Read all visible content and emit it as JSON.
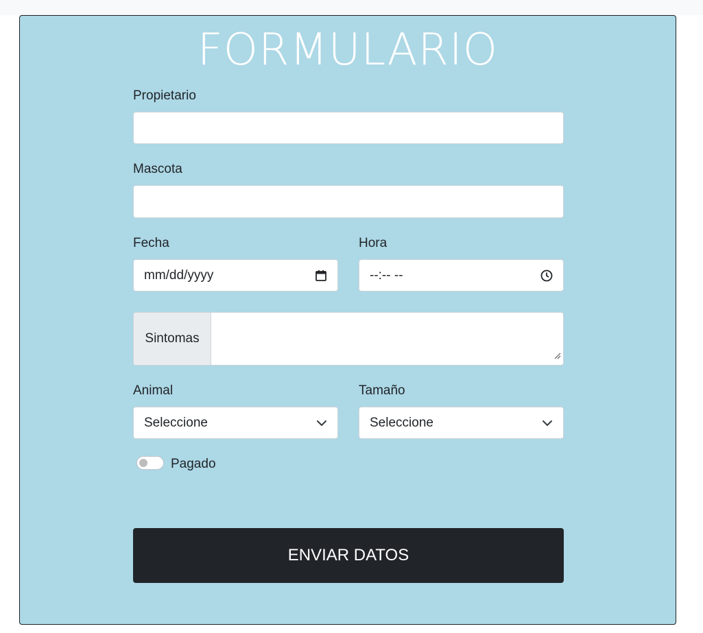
{
  "form": {
    "title": "FORMULARIO",
    "owner_label": "Propietario",
    "owner_value": "",
    "pet_label": "Mascota",
    "pet_value": "",
    "date_label": "Fecha",
    "date_placeholder": "mm/dd/yyyy",
    "time_label": "Hora",
    "time_placeholder": "--:-- --",
    "symptoms_addon": "Sintomas",
    "symptoms_value": "",
    "animal_label": "Animal",
    "animal_selected": "Seleccione",
    "size_label": "Tamaño",
    "size_selected": "Seleccione",
    "paid_label": "Pagado",
    "paid_checked": false,
    "submit_label": "ENVIAR DATOS"
  },
  "icons": {
    "date": "calendar-icon",
    "time": "clock-icon",
    "select": "chevron-down-icon",
    "resize": "resize-handle-icon"
  },
  "colors": {
    "card_background": "#add8e6",
    "button_background": "#212529",
    "title_color": "#ffffff"
  }
}
